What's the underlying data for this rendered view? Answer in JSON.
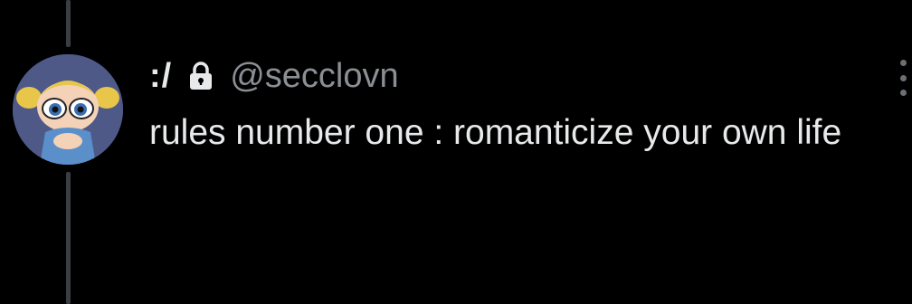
{
  "post": {
    "display_name": ":/",
    "username": "@secclovn",
    "text": "rules number one : romanticize your own life",
    "is_protected": true
  },
  "icons": {
    "lock": "lock-icon",
    "more": "more-options-icon",
    "avatar": "avatar-cartoon-girl"
  },
  "colors": {
    "background": "#000000",
    "text": "#e7e9ea",
    "muted": "#8b8f94",
    "thread_line": "#3a3d41"
  }
}
